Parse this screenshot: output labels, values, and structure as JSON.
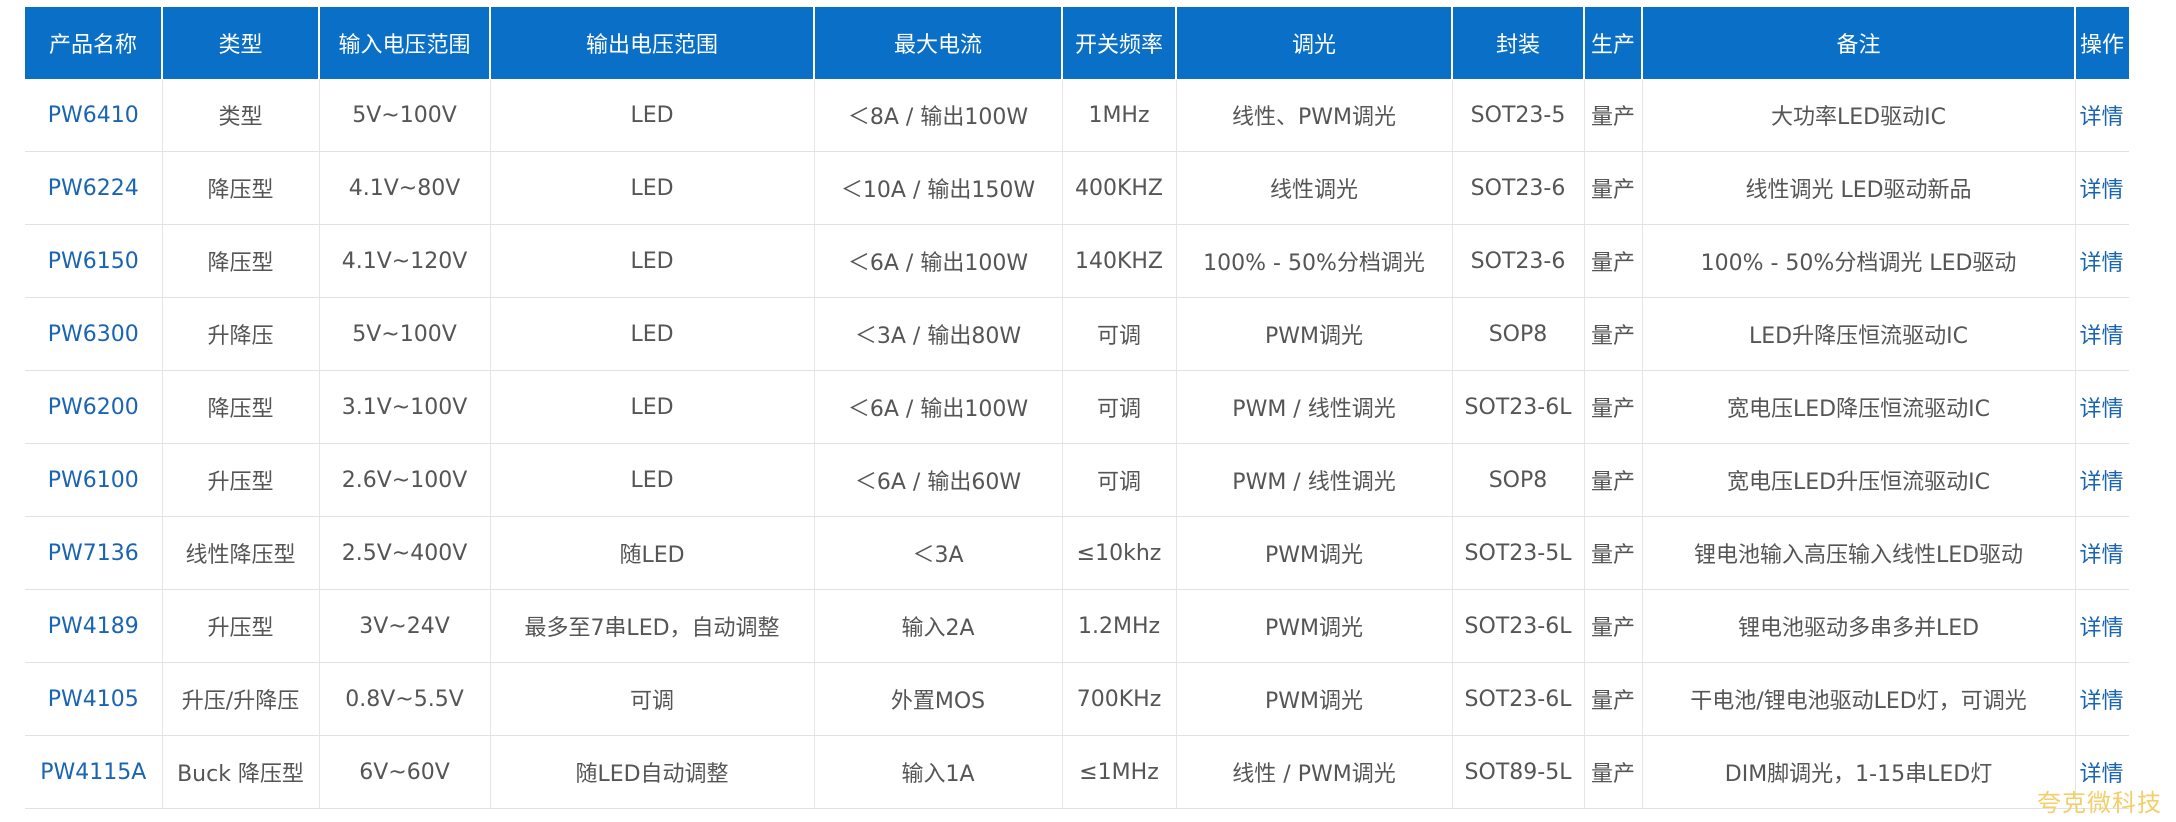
{
  "table": {
    "headers": [
      "产品名称",
      "类型",
      "输入电压范围",
      "输出电压范围",
      "最大电流",
      "开关频率",
      "调光",
      "封装",
      "生产",
      "备注",
      "操作"
    ],
    "rows": [
      {
        "model": "PW6410",
        "type": "类型",
        "vin": "5V~100V",
        "vout": "LED",
        "imax": "＜8A / 输出100W",
        "freq": "1MHz",
        "dimming": "线性、PWM调光",
        "package": "SOT23-5",
        "status": "量产",
        "remark": "大功率LED驱动IC",
        "action": "详情"
      },
      {
        "model": "PW6224",
        "type": "降压型",
        "vin": "4.1V~80V",
        "vout": "LED",
        "imax": "＜10A / 输出150W",
        "freq": "400KHZ",
        "dimming": "线性调光",
        "package": "SOT23-6",
        "status": "量产",
        "remark": "线性调光 LED驱动新品",
        "action": "详情"
      },
      {
        "model": "PW6150",
        "type": "降压型",
        "vin": "4.1V~120V",
        "vout": "LED",
        "imax": "＜6A / 输出100W",
        "freq": "140KHZ",
        "dimming": "100% - 50%分档调光",
        "package": "SOT23-6",
        "status": "量产",
        "remark": "100% - 50%分档调光 LED驱动",
        "action": "详情"
      },
      {
        "model": "PW6300",
        "type": "升降压",
        "vin": "5V~100V",
        "vout": "LED",
        "imax": "＜3A / 输出80W",
        "freq": "可调",
        "dimming": "PWM调光",
        "package": "SOP8",
        "status": "量产",
        "remark": "LED升降压恒流驱动IC",
        "action": "详情"
      },
      {
        "model": "PW6200",
        "type": "降压型",
        "vin": "3.1V~100V",
        "vout": "LED",
        "imax": "＜6A / 输出100W",
        "freq": "可调",
        "dimming": "PWM / 线性调光",
        "package": "SOT23-6L",
        "status": "量产",
        "remark": "宽电压LED降压恒流驱动IC",
        "action": "详情"
      },
      {
        "model": "PW6100",
        "type": "升压型",
        "vin": "2.6V~100V",
        "vout": "LED",
        "imax": "＜6A / 输出60W",
        "freq": "可调",
        "dimming": "PWM / 线性调光",
        "package": "SOP8",
        "status": "量产",
        "remark": "宽电压LED升压恒流驱动IC",
        "action": "详情"
      },
      {
        "model": "PW7136",
        "type": "线性降压型",
        "vin": "2.5V~400V",
        "vout": "随LED",
        "imax": "＜3A",
        "freq": "≤10khz",
        "dimming": "PWM调光",
        "package": "SOT23-5L",
        "status": "量产",
        "remark": "锂电池输入高压输入线性LED驱动",
        "action": "详情"
      },
      {
        "model": "PW4189",
        "type": "升压型",
        "vin": "3V~24V",
        "vout": "最多至7串LED，自动调整",
        "imax": "输入2A",
        "freq": "1.2MHz",
        "dimming": "PWM调光",
        "package": "SOT23-6L",
        "status": "量产",
        "remark": "锂电池驱动多串多并LED",
        "action": "详情"
      },
      {
        "model": "PW4105",
        "type": "升压/升降压",
        "vin": "0.8V~5.5V",
        "vout": "可调",
        "imax": "外置MOS",
        "freq": "700KHz",
        "dimming": "PWM调光",
        "package": "SOT23-6L",
        "status": "量产",
        "remark": "干电池/锂电池驱动LED灯，可调光",
        "action": "详情"
      },
      {
        "model": "PW4115A",
        "type": "Buck 降压型",
        "vin": "6V~60V",
        "vout": "随LED自动调整",
        "imax": "输入1A",
        "freq": "≤1MHz",
        "dimming": "线性 / PWM调光",
        "package": "SOT89-5L",
        "status": "量产",
        "remark": "DIM脚调光，1-15串LED灯",
        "action": "详情"
      }
    ]
  },
  "watermark": "夸克微科技",
  "colors": {
    "header_bg": "#0a6fc7",
    "link": "#1a64b4",
    "text": "#555555",
    "watermark": "#f3cf6a"
  }
}
